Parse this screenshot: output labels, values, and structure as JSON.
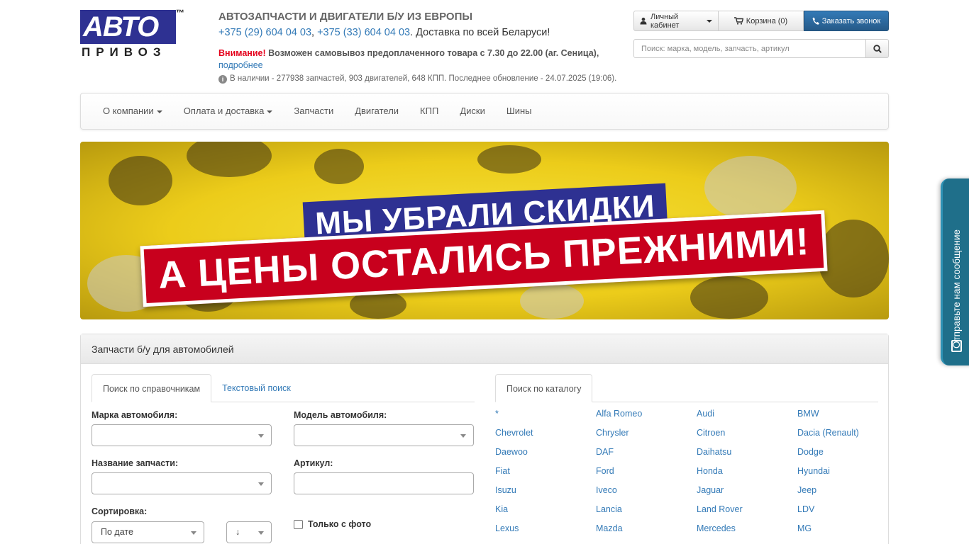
{
  "logo": {
    "word": "АВТО",
    "sub": "ПРИВОЗ",
    "tm": "™"
  },
  "header": {
    "title": "АВТОЗАПЧАСТИ И ДВИГАТЕЛИ Б/У ИЗ ЕВРОПЫ",
    "phone1": "+375 (29) 604 04 03",
    "phone_sep": ", ",
    "phone2": "+375 (33) 604 04 03",
    "delivery": ".  Доставка по всей Беларуси!",
    "warning_label": "Внимание!",
    "warning_text": " Возможен самовывоз предоплаченного товара с 7.30 до 22.00 (аг. Сеница),",
    "more_link": "подробнее",
    "stock": "В наличии - 277938 запчастей, 903 двигателей, 648 КПП. Последнее обновление - 24.07.2025 (19:06)."
  },
  "toolbar": {
    "cabinet": "Личный кабинет",
    "cart": "Корзина (0)",
    "callback": "Заказать звонок"
  },
  "search": {
    "placeholder": "Поиск: марка, модель, запчасть, артикул"
  },
  "nav": {
    "items": [
      "О компании",
      "Оплата и доставка",
      "Запчасти",
      "Двигатели",
      "КПП",
      "Диски",
      "Шины"
    ]
  },
  "banner": {
    "line1": "МЫ УБРАЛИ СКИДКИ",
    "line2": "А ЦЕНЫ ОСТАЛИСЬ ПРЕЖНИМИ!"
  },
  "panel": {
    "title": "Запчасти б/у для автомобилей",
    "tabs": [
      "Поиск по справочникам",
      "Текстовый поиск"
    ],
    "catalog_tab": "Поиск по каталогу",
    "brand_label": "Марка автомобиля:",
    "model_label": "Модель автомобиля:",
    "part_label": "Название запчасти:",
    "article_label": "Артикул:",
    "sort_label": "Сортировка:",
    "sort_value": "По дате",
    "sort_dir": "↓",
    "photo_only": "Только с фото"
  },
  "brands": [
    "*",
    "Alfa Romeo",
    "Audi",
    "BMW",
    "Chevrolet",
    "Chrysler",
    "Citroen",
    "Dacia (Renault)",
    "Daewoo",
    "DAF",
    "Daihatsu",
    "Dodge",
    "Fiat",
    "Ford",
    "Honda",
    "Hyundai",
    "Isuzu",
    "Iveco",
    "Jaguar",
    "Jeep",
    "Kia",
    "Lancia",
    "Land Rover",
    "LDV",
    "Lexus",
    "Mazda",
    "Mercedes",
    "MG"
  ],
  "feedback": {
    "label": "Отправьте нам сообщение"
  },
  "colors": {
    "brand_blue": "#2e3192",
    "banner_red": "#c8001d",
    "banner_yellow": "#f5e23a",
    "link": "#337ab7",
    "feedback": "#1f6f8a"
  }
}
